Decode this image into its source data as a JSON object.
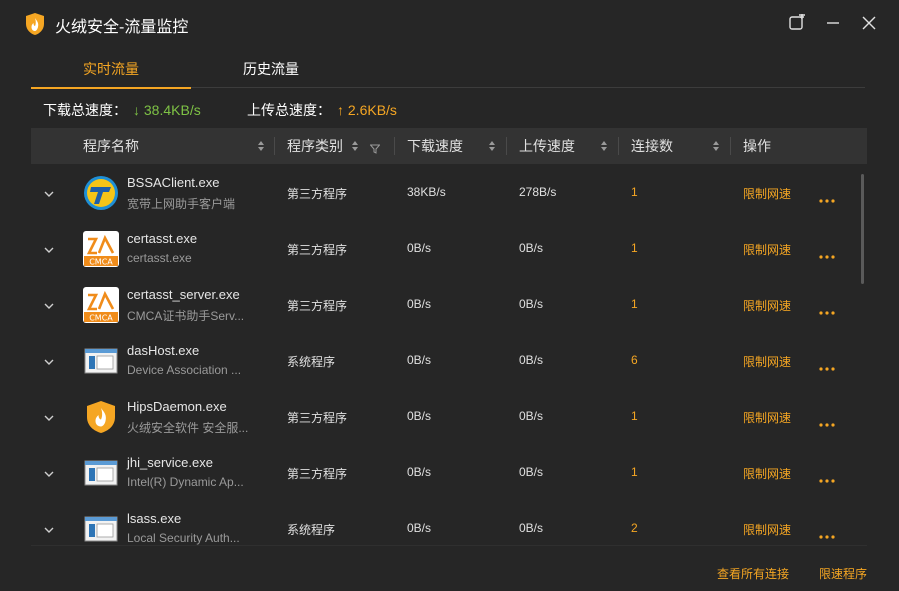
{
  "app": {
    "title": "火绒安全-流量监控",
    "logo_icon": "huorong-shield-icon"
  },
  "window_controls": {
    "pin_icon": "pin-window-icon",
    "minimize_icon": "minimize-icon",
    "close_icon": "close-icon"
  },
  "tabs": [
    {
      "label": "实时流量",
      "active": true
    },
    {
      "label": "历史流量",
      "active": false
    }
  ],
  "speeds": {
    "download_label": "下载总速度：",
    "download_value": "↓ 38.4KB/s",
    "upload_label": "上传总速度：",
    "upload_value": "↑ 2.6KB/s"
  },
  "table": {
    "columns": {
      "name": "程序名称",
      "type": "程序类别",
      "down": "下载速度",
      "up": "上传速度",
      "conn": "连接数",
      "op": "操作"
    },
    "rows": [
      {
        "name": "BSSAClient.exe",
        "desc": "宽带上网助手客户端",
        "type": "第三方程序",
        "down": "38KB/s",
        "up": "278B/s",
        "conn": "1",
        "action": "限制网速",
        "icon": "bssa-client-icon"
      },
      {
        "name": "certasst.exe",
        "desc": "certasst.exe",
        "type": "第三方程序",
        "down": "0B/s",
        "up": "0B/s",
        "conn": "1",
        "action": "限制网速",
        "icon": "cmca-icon"
      },
      {
        "name": "certasst_server.exe",
        "desc": "CMCA证书助手Serv...",
        "type": "第三方程序",
        "down": "0B/s",
        "up": "0B/s",
        "conn": "1",
        "action": "限制网速",
        "icon": "cmca-icon"
      },
      {
        "name": "dasHost.exe",
        "desc": "Device Association ...",
        "type": "系统程序",
        "down": "0B/s",
        "up": "0B/s",
        "conn": "6",
        "action": "限制网速",
        "icon": "system-program-icon"
      },
      {
        "name": "HipsDaemon.exe",
        "desc": "火绒安全软件 安全服...",
        "type": "第三方程序",
        "down": "0B/s",
        "up": "0B/s",
        "conn": "1",
        "action": "限制网速",
        "icon": "huorong-shield-icon"
      },
      {
        "name": "jhi_service.exe",
        "desc": "Intel(R) Dynamic Ap...",
        "type": "第三方程序",
        "down": "0B/s",
        "up": "0B/s",
        "conn": "1",
        "action": "限制网速",
        "icon": "system-program-icon"
      },
      {
        "name": "lsass.exe",
        "desc": "Local Security Auth...",
        "type": "系统程序",
        "down": "0B/s",
        "up": "0B/s",
        "conn": "2",
        "action": "限制网速",
        "icon": "system-program-icon"
      }
    ]
  },
  "footer": {
    "view_all": "查看所有连接",
    "limit_programs": "限速程序"
  },
  "colors": {
    "accent": "#f5a623",
    "download_green": "#7ec245",
    "background": "#262626",
    "header_bg": "#333333"
  }
}
